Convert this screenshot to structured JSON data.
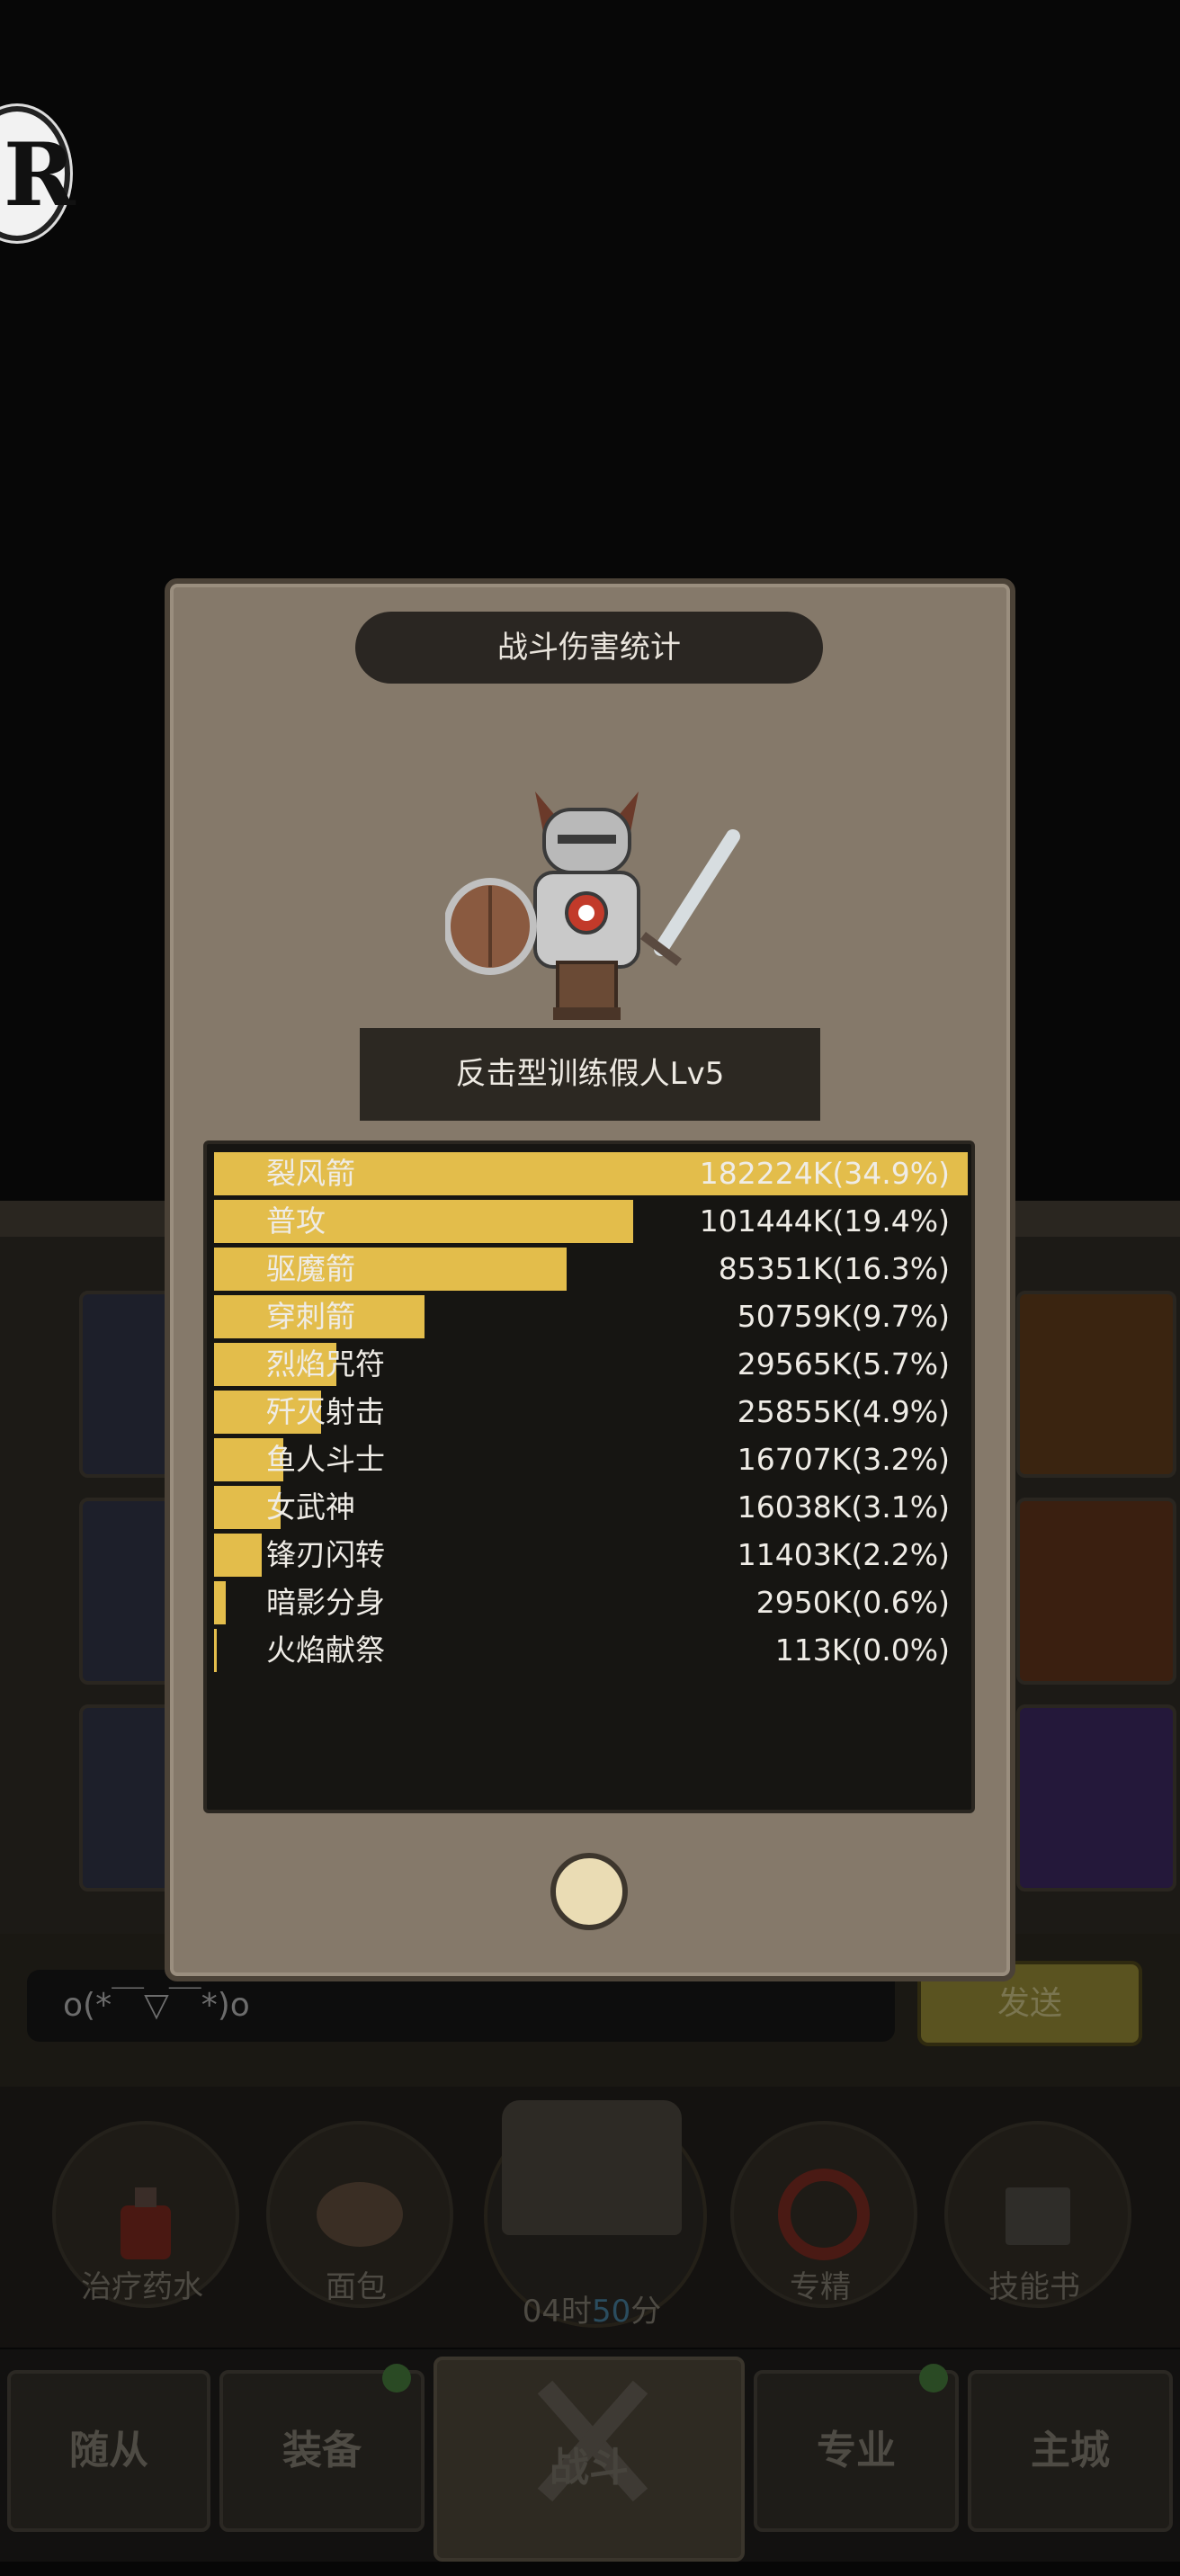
{
  "logo": {
    "letter": "R"
  },
  "modal": {
    "title": "战斗伤害统计",
    "enemy_name": "反击型训练假人Lv5",
    "rows": [
      {
        "label": "裂风箭",
        "value": "182224K(34.9%)",
        "share": 1.0
      },
      {
        "label": "普攻",
        "value": "101444K(19.4%)",
        "share": 0.556
      },
      {
        "label": "驱魔箭",
        "value": "85351K(16.3%)",
        "share": 0.468
      },
      {
        "label": "穿刺箭",
        "value": "50759K(9.7%)",
        "share": 0.279
      },
      {
        "label": "烈焰咒符",
        "value": "29565K(5.7%)",
        "share": 0.162
      },
      {
        "label": "歼灭射击",
        "value": "25855K(4.9%)",
        "share": 0.142
      },
      {
        "label": "鱼人斗士",
        "value": "16707K(3.2%)",
        "share": 0.092
      },
      {
        "label": "女武神",
        "value": "16038K(3.1%)",
        "share": 0.088
      },
      {
        "label": "锋刃闪转",
        "value": "11403K(2.2%)",
        "share": 0.063
      },
      {
        "label": "暗影分身",
        "value": "2950K(0.6%)",
        "share": 0.016
      },
      {
        "label": "火焰献祭",
        "value": "113K(0.0%)",
        "share": 0.002
      }
    ]
  },
  "chat": {
    "input_value": "o(*￣▽￣*)o",
    "send_label": "发送"
  },
  "items": [
    {
      "label": "治疗药水",
      "icon": "potion-icon"
    },
    {
      "label": "面包",
      "icon": "bread-icon"
    },
    {
      "label": "专精",
      "icon": "specialization-icon"
    },
    {
      "label": "技能书",
      "icon": "skill-book-icon"
    }
  ],
  "timer": {
    "hours": "04时",
    "minutes": "50",
    "unit": "分"
  },
  "nav": {
    "followers": "随从",
    "equipment": "装备",
    "battle": "战斗",
    "profession": "专业",
    "main_city": "主城"
  },
  "colors": {
    "bar": "#e3bd4b",
    "modal_bg": "#85796a",
    "panel_dark": "#161512"
  }
}
